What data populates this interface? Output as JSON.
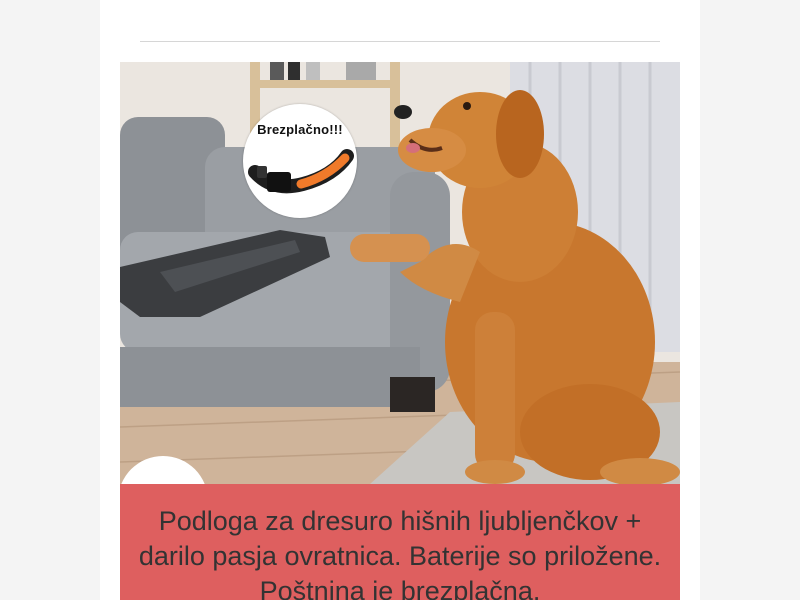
{
  "product": {
    "badge_label": "Brezplačno!!!",
    "description": "Podloga za dresuro hišnih ljubljenčkov + darilo pasja ovratnica. Baterije so priložene. Poštnina je brezplačna."
  },
  "colors": {
    "caption_bg": "#de5f5f",
    "page_bg": "#f4f4f4",
    "collar_accent": "#f07a2a"
  }
}
